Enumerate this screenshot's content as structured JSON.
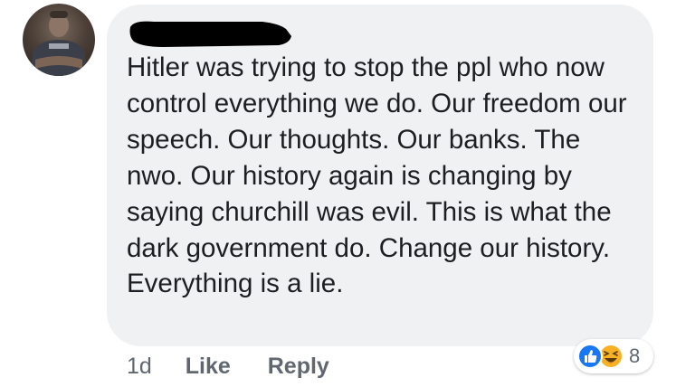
{
  "comment": {
    "text": "Hitler was trying to stop the ppl who now control everything we do. Our freedom our speech. Our thoughts. Our banks. The nwo. Our history again is changing by saying churchill was evil. This is what the dark government do. Change our history. Everything is a lie.",
    "timestamp": "1d",
    "like_label": "Like",
    "reply_label": "Reply"
  },
  "reactions": {
    "icons": [
      "like-icon",
      "haha-icon"
    ],
    "count": "8",
    "like_color": "#1877f2",
    "haha_color": "#f7b125"
  },
  "colors": {
    "bubble_bg": "#f0f1f3",
    "text": "#1c1e21",
    "meta_text": "#606770"
  }
}
